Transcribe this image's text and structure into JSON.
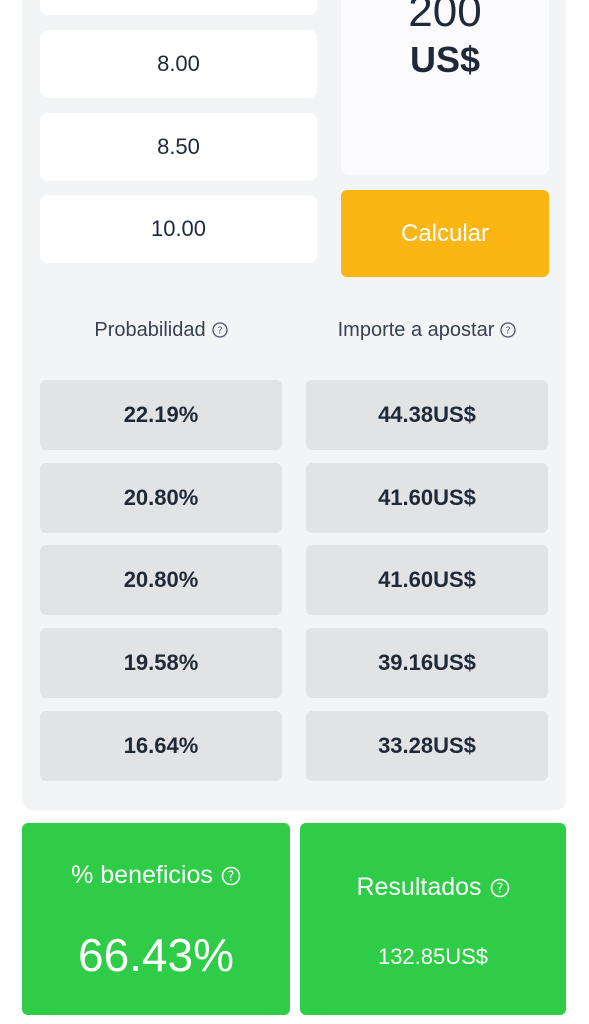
{
  "odds": [
    "8.00",
    "8.50",
    "10.00"
  ],
  "stake": {
    "amount": "200",
    "currency": "US$"
  },
  "calculate_label": "Calcular",
  "headers": {
    "probability": "Probabilidad",
    "stake_amount": "Importe a apostar"
  },
  "rows": [
    {
      "probability": "22.19%",
      "amount": "44.38US$"
    },
    {
      "probability": "20.80%",
      "amount": "41.60US$"
    },
    {
      "probability": "20.80%",
      "amount": "41.60US$"
    },
    {
      "probability": "19.58%",
      "amount": "39.16US$"
    },
    {
      "probability": "16.64%",
      "amount": "33.28US$"
    }
  ],
  "profit": {
    "label": "% beneficios",
    "value": "66.43%"
  },
  "results": {
    "label": "Resultados",
    "value": "132.85US$"
  },
  "colors": {
    "panel": "#f3f4f6",
    "accent": "#fbb614",
    "success": "#2ecc47",
    "cell": "#e2e3e5"
  }
}
